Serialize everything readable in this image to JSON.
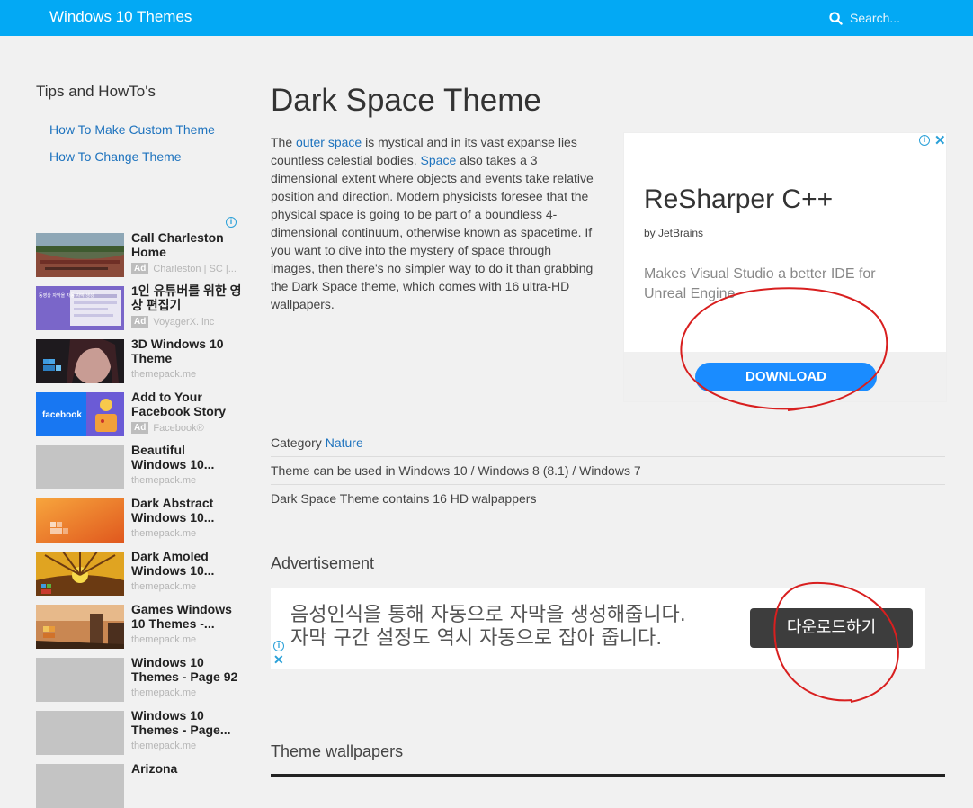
{
  "header": {
    "site_title": "Windows 10 Themes",
    "search_placeholder": "Search..."
  },
  "sidebar": {
    "heading": "Tips and HowTo's",
    "links": [
      "How To Make Custom Theme",
      "How To Change Theme"
    ]
  },
  "recommendations": [
    {
      "title": "Call Charleston Home",
      "source": "Charleston | SC |...",
      "ad": true,
      "ad_label": "Ad"
    },
    {
      "title": "1인 유튜버를 위한 영상 편집기",
      "source": "VoyagerX. inc",
      "ad": true,
      "ad_label": "Ad",
      "thumb_text": "동영상 자막을 자동 자막 생성"
    },
    {
      "title": "3D Windows 10 Theme",
      "source": "themepack.me",
      "ad": false
    },
    {
      "title": "Add to Your Facebook Story",
      "source": "Facebook®",
      "ad": true,
      "ad_label": "Ad",
      "thumb_text": "facebook"
    },
    {
      "title": "Beautiful Windows 10...",
      "source": "themepack.me",
      "ad": false
    },
    {
      "title": "Dark Abstract Windows 10...",
      "source": "themepack.me",
      "ad": false
    },
    {
      "title": "Dark Amoled Windows 10...",
      "source": "themepack.me",
      "ad": false
    },
    {
      "title": "Games Windows 10 Themes -...",
      "source": "themepack.me",
      "ad": false
    },
    {
      "title": "Windows 10 Themes - Page 92",
      "source": "themepack.me",
      "ad": false
    },
    {
      "title": "Windows 10 Themes - Page...",
      "source": "themepack.me",
      "ad": false
    },
    {
      "title": "Arizona",
      "source": "",
      "ad": false
    }
  ],
  "article": {
    "title": "Dark Space Theme",
    "intro": {
      "p1": "The ",
      "link1": "outer space",
      "p2": " is mystical and in its vast expanse lies countless celestial bodies. ",
      "link2": "Space",
      "p3": " also takes a 3 dimensional extent where objects and events take relative position and direction. Modern physicists foresee that the physical space is going to be part of a boundless 4-dimensional continuum, otherwise known as spacetime. If you want to dive into the mystery of space through images, then there's no simpler way to do it than grabbing the Dark Space theme, which comes with 16 ultra-HD wallpapers."
    },
    "category_label": "Category ",
    "category": "Nature",
    "compat": "Theme can be used in Windows 10 / Windows 8 (8.1) / Windows 7",
    "contains": "Dark Space Theme contains 16 HD walpappers",
    "advert_heading": "Advertisement",
    "wallpapers_heading": "Theme wallpapers"
  },
  "ad_box": {
    "title": "ReSharper C++",
    "subtitle": "by JetBrains",
    "description": "Makes Visual Studio a better IDE for Unreal Engine",
    "button": "DOWNLOAD"
  },
  "ad_banner": {
    "line1": "음성인식을 통해 자동으로 자막을 생성해줍니다.",
    "line2": "자막 구간 설정도 역시 자동으로 잡아 줍니다.",
    "button": "다운로드하기"
  },
  "icons": {
    "search": "search-icon",
    "adchoices": "adchoices-icon",
    "close": "close-icon"
  },
  "colors": {
    "topbar": "#03a9f4",
    "link": "#1e73be",
    "ad_button": "#1a8cff",
    "annotation": "#d81f1f"
  }
}
